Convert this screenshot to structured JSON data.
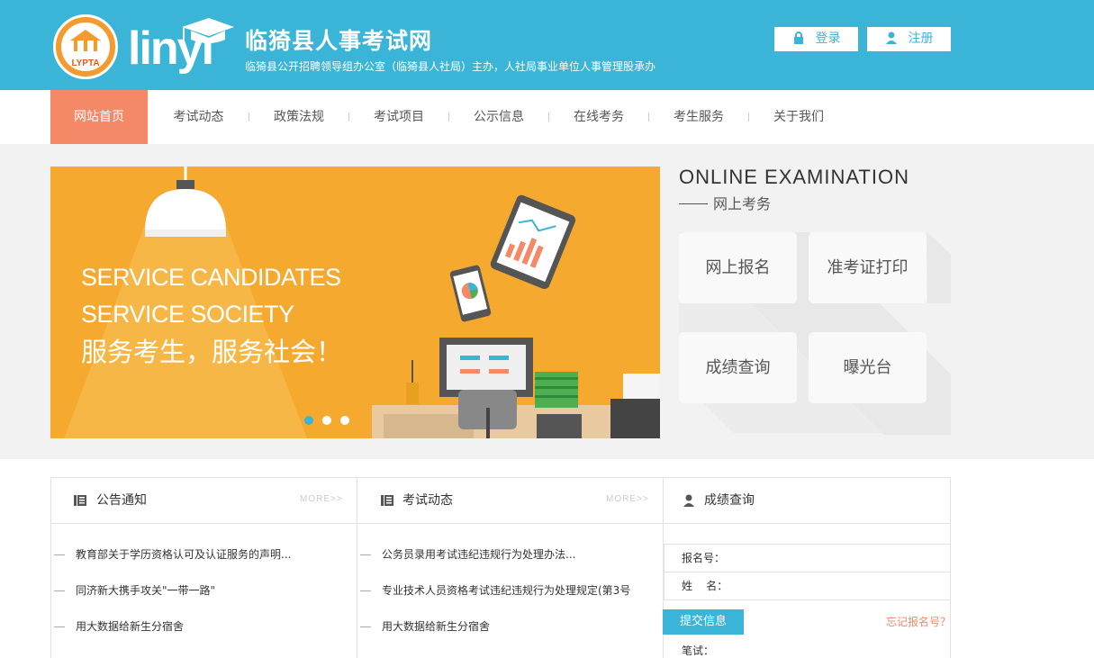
{
  "header": {
    "logo_text": "LYPTA",
    "brand_en": "linyi",
    "site_title": "临猗县人事考试网",
    "site_subtitle": "临猗县公开招聘领导组办公室（临猗县人社局）主办，人社局事业单位人事管理股承办",
    "login_label": "登录",
    "register_label": "注册",
    "lock_icon": "lock-icon",
    "user_icon": "user-icon"
  },
  "nav": {
    "items": [
      "网站首页",
      "考试动态",
      "政策法规",
      "考试项目",
      "公示信息",
      "在线考务",
      "考生服务",
      "关于我们"
    ],
    "active": "网站首页"
  },
  "banner": {
    "slogan_en_1": "SERVICE CANDIDATES",
    "slogan_en_2": "SERVICE SOCIETY",
    "slogan_cn": "服务考生，服务社会！",
    "slides": 3,
    "active_slide": 1,
    "bg_color": "#f5a92f"
  },
  "online": {
    "title": "ONLINE EXAMINATION",
    "subtitle": "网上考务",
    "tiles": [
      "网上报名",
      "准考证打印",
      "成绩查询",
      "曝光台"
    ]
  },
  "notices": {
    "title": "公告通知",
    "more": "MORE>>",
    "items": [
      "教育部关于学历资格认可及认证服务的声明...",
      "同济新大携手攻关\"一带一路\"",
      "用大数据给新生分宿舍"
    ]
  },
  "exam_news": {
    "title": "考试动态",
    "more": "MORE>>",
    "items": [
      "公务员录用考试违纪违规行为处理办法...",
      "专业技术人员资格考试违纪违规行为处理规定(第3号",
      "用大数据给新生分宿舍"
    ]
  },
  "score_query": {
    "title": "成绩查询",
    "reg_no_label": "报名号：",
    "name_label": "姓    名：",
    "submit_label": "提交信息",
    "forgot_label": "忘记报名号？",
    "written_label": "笔试："
  },
  "colors": {
    "header_bg": "#3ab5d8",
    "nav_active": "#f48867",
    "accent": "#3ab5d8"
  }
}
